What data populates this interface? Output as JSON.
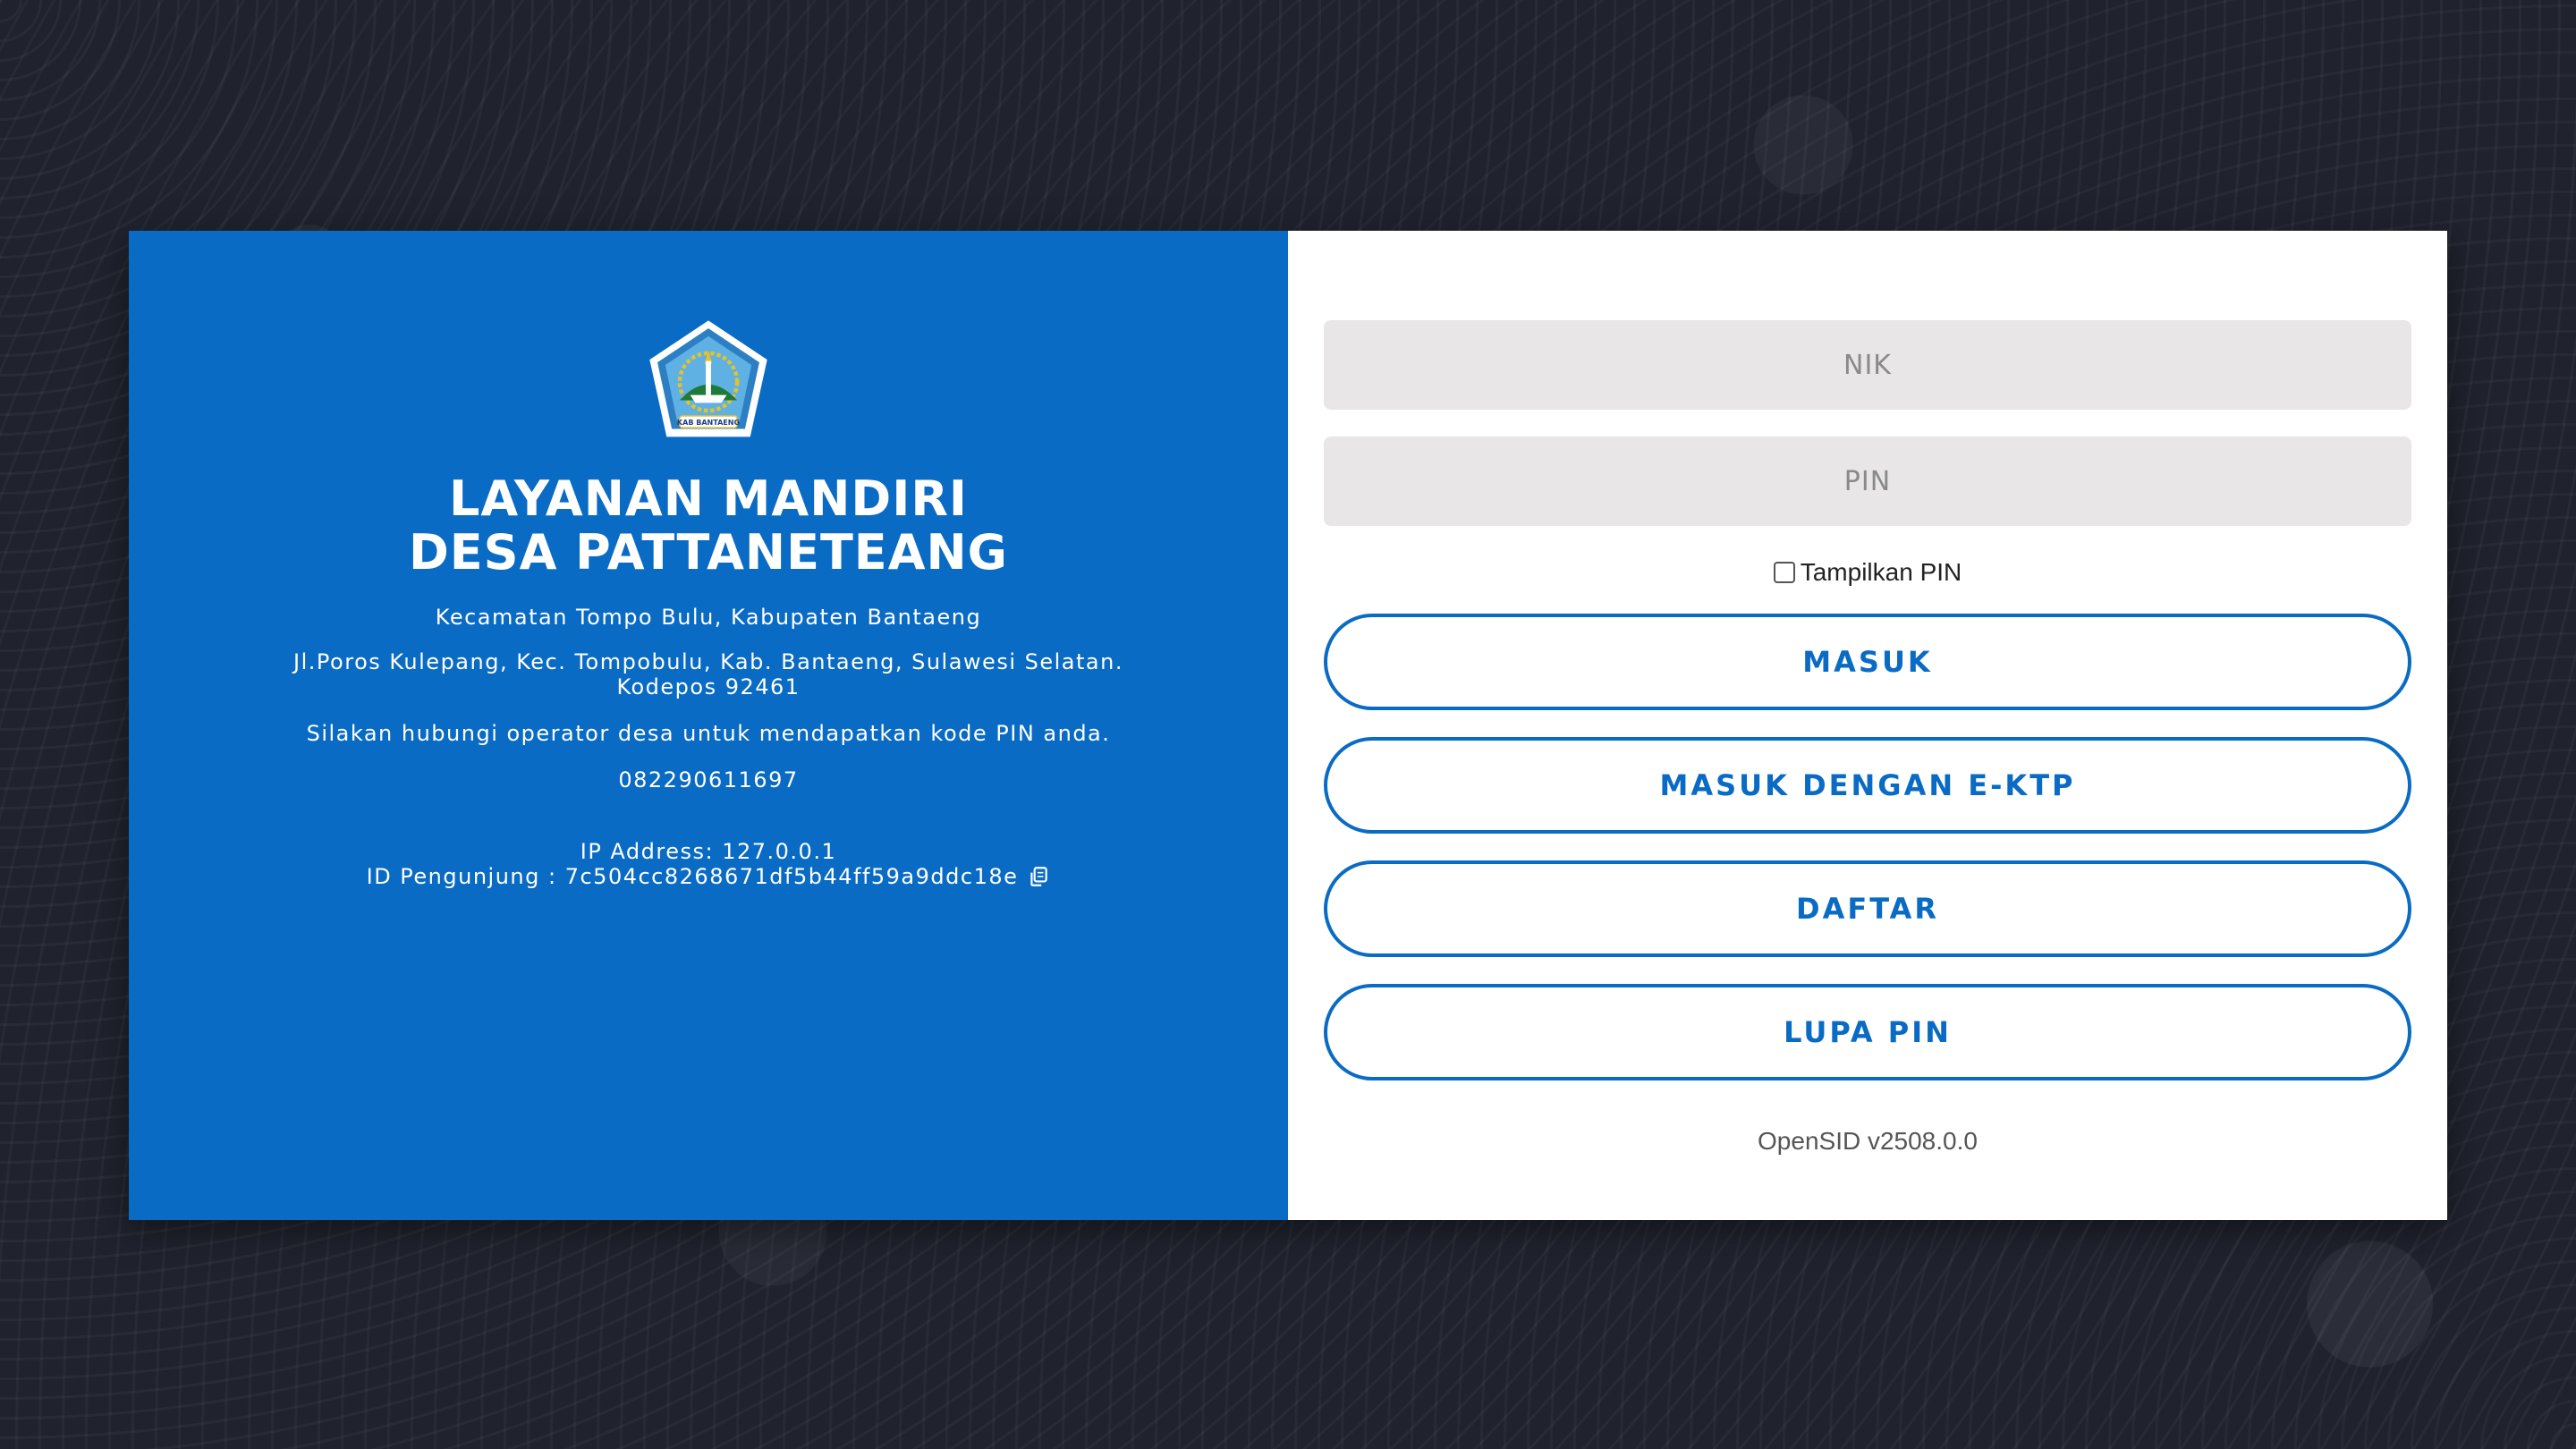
{
  "brand": {
    "title_line1": "LAYANAN MANDIRI",
    "title_line2": "DESA PATTANETEANG",
    "logo_text": "KAB BANTAENG",
    "subdistrict": "Kecamatan Tompo Bulu, Kabupaten Bantaeng",
    "address": "Jl.Poros Kulepang, Kec. Tompobulu, Kab. Bantaeng, Sulawesi Selatan. Kodepos 92461",
    "notice": "Silakan hubungi operator desa untuk mendapatkan kode PIN anda.",
    "phone": "082290611697",
    "ip_address": "IP Address: 127.0.0.1",
    "visitor_id": "ID Pengunjung : 7c504cc8268671df5b44ff59a9ddc18e"
  },
  "login": {
    "nik_placeholder": "NIK",
    "pin_placeholder": "PIN",
    "show_pin_label": "Tampilkan PIN",
    "masuk_label": "MASUK",
    "masuk_ektp_label": "MASUK DENGAN E-KTP",
    "daftar_label": "DAFTAR",
    "lupa_pin_label": "LUPA PIN",
    "version": "OpenSID v2508.0.0"
  },
  "colors": {
    "primary": "#0a6bc4",
    "background": "#20232e",
    "input_bg": "#e8e6e7"
  },
  "icons": {
    "logo": "kabupaten-bantaeng-emblem",
    "copy": "copy-icon"
  }
}
